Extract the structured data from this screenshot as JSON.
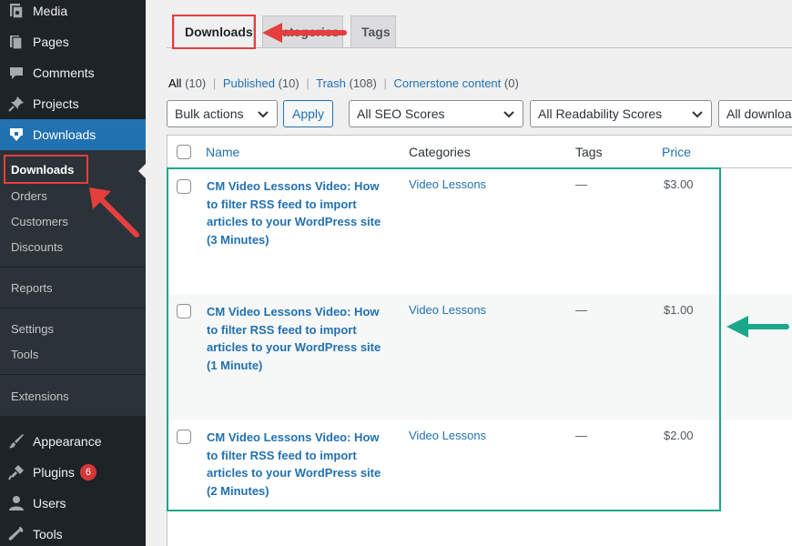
{
  "sidebar": {
    "items": [
      {
        "label": "Media",
        "icon": "media-icon"
      },
      {
        "label": "Pages",
        "icon": "pages-icon"
      },
      {
        "label": "Comments",
        "icon": "comments-icon"
      },
      {
        "label": "Projects",
        "icon": "pin-icon"
      },
      {
        "label": "Downloads",
        "icon": "download-icon"
      },
      {
        "label": "Appearance",
        "icon": "brush-icon"
      },
      {
        "label": "Plugins",
        "icon": "plugin-icon",
        "badge": "6"
      },
      {
        "label": "Users",
        "icon": "user-icon"
      },
      {
        "label": "Tools",
        "icon": "wrench-icon"
      }
    ],
    "submenu": [
      "Downloads",
      "Orders",
      "Customers",
      "Discounts",
      "Reports",
      "Settings",
      "Tools",
      "Extensions"
    ]
  },
  "tabs": [
    "Downloads",
    "Categories",
    "Tags"
  ],
  "filters": {
    "all": "All",
    "all_count": "(10)",
    "published": "Published",
    "published_count": "(10)",
    "trash": "Trash",
    "trash_count": "(108)",
    "cornerstone": "Cornerstone content",
    "cornerstone_count": "(0)",
    "sep": "|"
  },
  "actions": {
    "bulk": "Bulk actions",
    "apply": "Apply",
    "seo": "All SEO Scores",
    "readability": "All Readability Scores",
    "downloads": "All download categories"
  },
  "table": {
    "headers": {
      "name": "Name",
      "categories": "Categories",
      "tags": "Tags",
      "price": "Price"
    },
    "rows": [
      {
        "title": "CM Video Lessons Video: How to filter RSS feed to import articles to your WordPress site (3 Minutes)",
        "category": "Video Lessons",
        "tags": "—",
        "price": "$3.00"
      },
      {
        "title": "CM Video Lessons Video: How to filter RSS feed to import articles to your WordPress site (1 Minute)",
        "category": "Video Lessons",
        "tags": "—",
        "price": "$1.00"
      },
      {
        "title": "CM Video Lessons Video: How to filter RSS feed to import articles to your WordPress site (2 Minutes)",
        "category": "Video Lessons",
        "tags": "—",
        "price": "$2.00"
      }
    ]
  },
  "colors": {
    "sidebar_bg": "#1d2327",
    "active_blue": "#2271b1",
    "annotation_red": "#e53e3e",
    "annotation_green": "#1aa88a"
  }
}
